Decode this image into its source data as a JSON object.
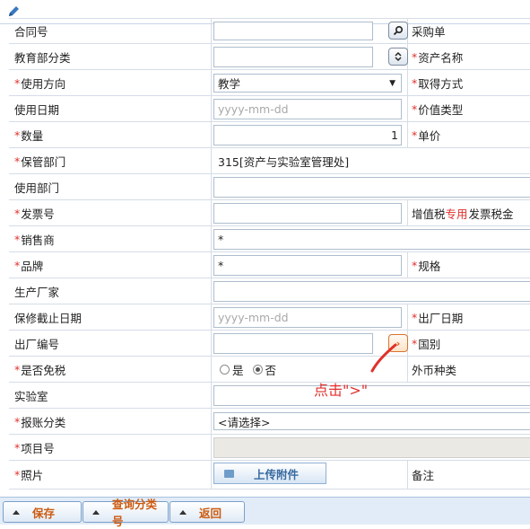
{
  "toolbar": {
    "edit_icon": "pencil-icon"
  },
  "rows": {
    "contract": {
      "label": "合同号",
      "label2": "采购单"
    },
    "edu_category": {
      "label": "教育部分类",
      "label2": "资产名称"
    },
    "use_direction": {
      "label": "使用方向",
      "value": "教学",
      "label2": "取得方式"
    },
    "use_date": {
      "label": "使用日期",
      "placeholder": "yyyy-mm-dd",
      "label2": "价值类型"
    },
    "quantity": {
      "label": "数量",
      "value": "1",
      "label2": "单价"
    },
    "custody_dept": {
      "label": "保管部门",
      "value": "315[资产与实验室管理处]"
    },
    "use_dept": {
      "label": "使用部门"
    },
    "invoice": {
      "label": "发票号",
      "label2_pre": "增值税",
      "label2_highlight": "专用",
      "label2_post": "发票税金"
    },
    "seller": {
      "label": "销售商",
      "value": "*"
    },
    "brand": {
      "label": "品牌",
      "value": "*",
      "label2": "规格"
    },
    "manufacturer": {
      "label": "生产厂家"
    },
    "warranty": {
      "label": "保修截止日期",
      "placeholder": "yyyy-mm-dd",
      "label2": "出厂日期"
    },
    "serial": {
      "label": "出厂编号",
      "label2": "国别"
    },
    "tax_free": {
      "label": "是否免税",
      "opt_yes": "是",
      "opt_no": "否",
      "label2": "外币种类"
    },
    "lab": {
      "label": "实验室"
    },
    "reimburse": {
      "label": "报账分类",
      "value": "<请选择>"
    },
    "project": {
      "label": "项目号"
    },
    "photo": {
      "label": "照片",
      "upload_label": "上传附件",
      "label2": "备注"
    }
  },
  "annotation": {
    "text": "点击\">\""
  },
  "bottom": {
    "save": "保存",
    "query": "查询分类号",
    "back": "返回"
  },
  "colors": {
    "required": "#e0302c",
    "accent": "#cc5b11",
    "border": "#d5dde7"
  }
}
